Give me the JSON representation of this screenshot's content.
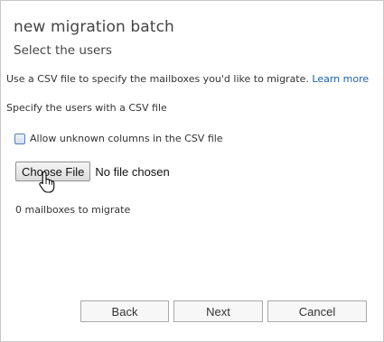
{
  "dialog": {
    "title": "new migration batch",
    "subtitle": "Select the users"
  },
  "content": {
    "description": "Use a CSV file to specify the mailboxes you'd like to migrate.",
    "learn_more_label": "Learn more",
    "specify_label": "Specify the users with a CSV file",
    "allow_unknown_label": "Allow unknown columns in the CSV file",
    "allow_unknown_checked": false,
    "choose_file_label": "Choose File",
    "file_status": "No file chosen",
    "mailbox_count_text": "0 mailboxes to migrate"
  },
  "footer": {
    "back_label": "Back",
    "next_label": "Next",
    "cancel_label": "Cancel"
  },
  "colors": {
    "link": "#1a5fa8",
    "border": "#c8c8c8",
    "button_bg": "#f7f7f7"
  },
  "icons": [
    "hand-pointer-cursor-icon"
  ]
}
